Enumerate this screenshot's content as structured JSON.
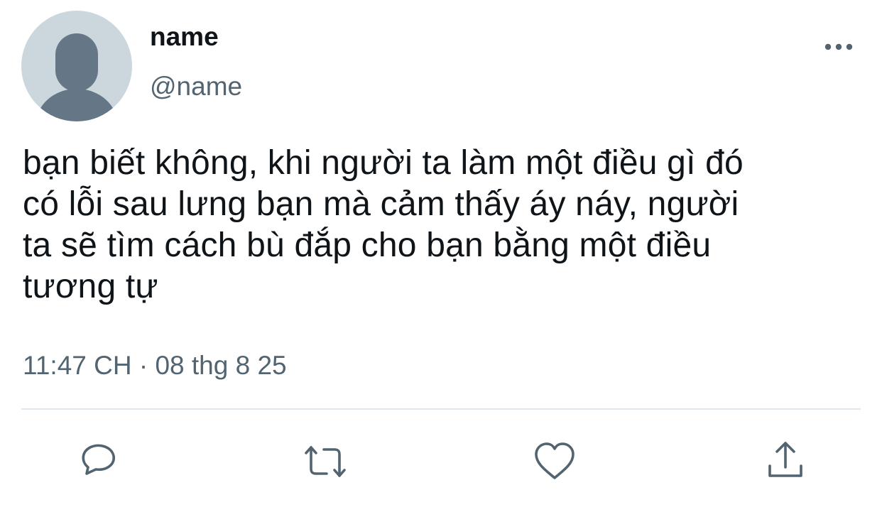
{
  "tweet": {
    "author": {
      "display_name": "name",
      "handle": "@name",
      "avatar_icon": "default-avatar-icon"
    },
    "more_icon": "more-options-icon",
    "text": "bạn biết không, khi người ta làm một điều gì đó\ncó lỗi sau lưng bạn mà cảm thấy áy náy, người\nta sẽ tìm cách bù đắp cho bạn bằng một điều\ntương tự",
    "time": "11:47 CH",
    "separator": "·",
    "date": "08 thg 8 25"
  },
  "actions": [
    {
      "name": "reply",
      "icon": "reply-icon"
    },
    {
      "name": "retweet",
      "icon": "retweet-icon"
    },
    {
      "name": "like",
      "icon": "heart-icon"
    },
    {
      "name": "share",
      "icon": "share-icon"
    }
  ],
  "colors": {
    "text_primary": "#0f1419",
    "text_secondary": "#536471",
    "avatar_bg": "#ccd6dd",
    "avatar_fg": "#657786",
    "divider": "#e1e8ed"
  }
}
